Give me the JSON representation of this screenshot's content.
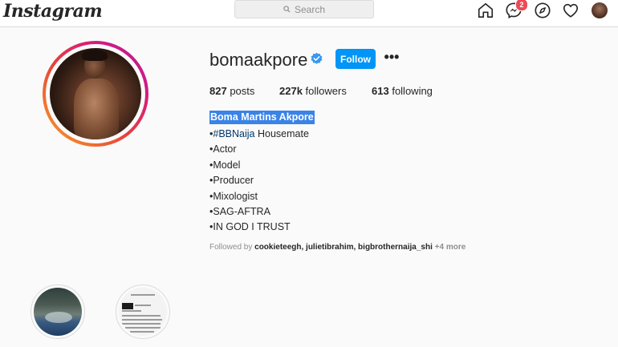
{
  "nav": {
    "logo": "Instagram",
    "search_placeholder": "Search",
    "messages_badge": "2",
    "icons": [
      "home-icon",
      "messenger-icon",
      "explore-icon",
      "heart-icon"
    ]
  },
  "profile": {
    "username": "bomaakpore",
    "verified": true,
    "follow_label": "Follow",
    "more_label": "•••",
    "stats": {
      "posts_count": "827",
      "posts_label": "posts",
      "followers_count": "227k",
      "followers_label": "followers",
      "following_count": "613",
      "following_label": "following"
    },
    "full_name": "Boma Martins Akpore",
    "bio": {
      "line1_prefix": "•",
      "line1_hashtag": "#BBNaija",
      "line1_suffix": " Housemate",
      "line2": "•Actor",
      "line3": "•Model",
      "line4": "•Producer",
      "line5": "•Mixologist",
      "line6": "•SAG-AFTRA",
      "line7": "•IN GOD I TRUST"
    },
    "followed_by": {
      "prefix": "Followed by ",
      "names": "cookieteegh, julietibrahim, bigbrothernaija_shi",
      "more": " +4 more"
    }
  },
  "colors": {
    "accent": "#0095f6",
    "selection": "#3a83e8",
    "badge": "#ed4956"
  }
}
